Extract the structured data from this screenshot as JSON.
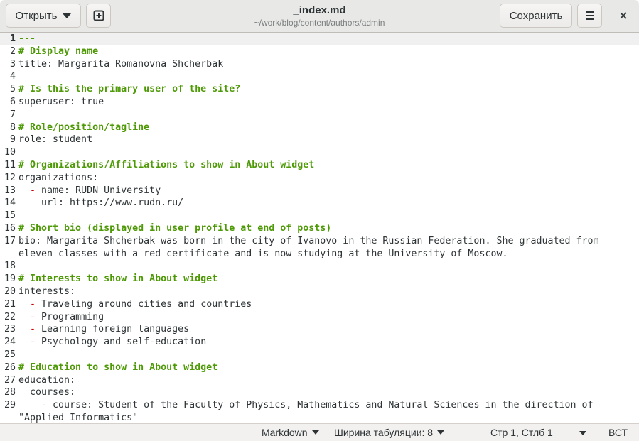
{
  "header": {
    "open_label": "Открыть",
    "new_tab_icon": "plus-square-icon",
    "title": "_index.md",
    "path": "~/work/blog/content/authors/admin",
    "save_label": "Сохранить",
    "menu_icon": "hamburger-icon",
    "close_icon": "close-icon"
  },
  "lines": [
    {
      "n": "1",
      "t": "cm",
      "text": "---"
    },
    {
      "n": "2",
      "t": "cm",
      "text": "# Display name"
    },
    {
      "n": "3",
      "t": "tx",
      "text": "title: Margarita Romanovna Shcherbak"
    },
    {
      "n": "4",
      "t": "tx",
      "text": ""
    },
    {
      "n": "5",
      "t": "cm",
      "text": "# Is this the primary user of the site?"
    },
    {
      "n": "6",
      "t": "tx",
      "text": "superuser: true"
    },
    {
      "n": "7",
      "t": "tx",
      "text": ""
    },
    {
      "n": "8",
      "t": "cm",
      "text": "# Role/position/tagline"
    },
    {
      "n": "9",
      "t": "tx",
      "text": "role: student"
    },
    {
      "n": "10",
      "t": "tx",
      "text": ""
    },
    {
      "n": "11",
      "t": "cm",
      "text": "# Organizations/Affiliations to show in About widget"
    },
    {
      "n": "12",
      "t": "tx",
      "text": "organizations:"
    },
    {
      "n": "13",
      "t": "li",
      "indent": "  ",
      "text": " name: RUDN University"
    },
    {
      "n": "14",
      "t": "tx",
      "text": "    url: https://www.rudn.ru/"
    },
    {
      "n": "15",
      "t": "tx",
      "text": ""
    },
    {
      "n": "16",
      "t": "cm",
      "text": "# Short bio (displayed in user profile at end of posts)"
    },
    {
      "n": "17",
      "t": "tx",
      "text": "bio: Margarita Shcherbak was born in the city of Ivanovo in the Russian Federation. She graduated from eleven classes with a red certificate and is now studying at the University of Moscow."
    },
    {
      "n": "18",
      "t": "tx",
      "text": ""
    },
    {
      "n": "19",
      "t": "cm",
      "text": "# Interests to show in About widget"
    },
    {
      "n": "20",
      "t": "tx",
      "text": "interests:"
    },
    {
      "n": "21",
      "t": "li",
      "indent": "  ",
      "text": " Traveling around cities and countries"
    },
    {
      "n": "22",
      "t": "li",
      "indent": "  ",
      "text": " Programming"
    },
    {
      "n": "23",
      "t": "li",
      "indent": "  ",
      "text": " Learning foreign languages"
    },
    {
      "n": "24",
      "t": "li",
      "indent": "  ",
      "text": " Psychology and self-education"
    },
    {
      "n": "25",
      "t": "tx",
      "text": ""
    },
    {
      "n": "26",
      "t": "cm",
      "text": "# Education to show in About widget"
    },
    {
      "n": "27",
      "t": "tx",
      "text": "education:"
    },
    {
      "n": "28",
      "t": "tx",
      "text": "  courses:"
    },
    {
      "n": "29",
      "t": "tx",
      "text": "    - course: Student of the Faculty of Physics, Mathematics and Natural Sciences in the direction of \"Applied Informatics\""
    }
  ],
  "status": {
    "language": "Markdown",
    "tab_width": "Ширина табуляции: 8",
    "position": "Стр 1, Стлб 1",
    "mode": "ВСТ"
  }
}
